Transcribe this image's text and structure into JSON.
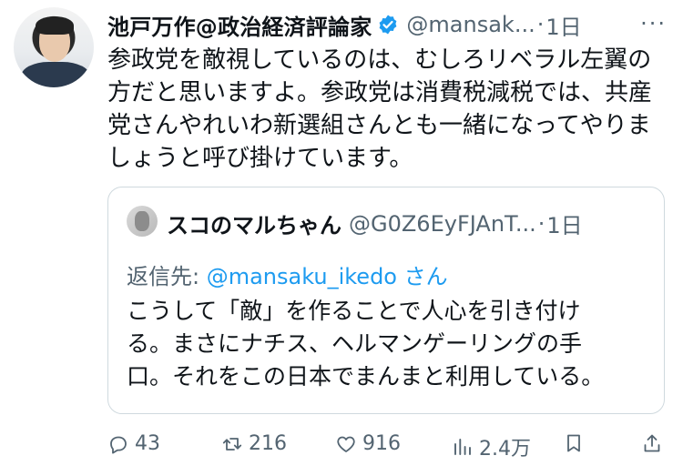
{
  "tweet": {
    "author_name": "池戸万作@政治経済評論家",
    "handle": "@mansak...",
    "time_sep": "·",
    "time": "1日",
    "more": "···",
    "text": "参政党を敵視しているのは、むしろリベラル左翼の\n方だと思いますよ。参政党は消費税減税では、共産\n党さんやれいわ新選組さんとも一緒になってやりま\nしょうと呼び掛けています。"
  },
  "quote": {
    "author_name": "スコのマルちゃん",
    "handle": "@G0Z6EyFJAnT...",
    "time_sep": "·",
    "time": "1日",
    "reply_prefix": "返信先: ",
    "reply_link": "@mansaku_ikedo",
    "reply_suffix": " さん",
    "text": "こうして「敵」を作ることで人心を引き付け\nる。まさにナチス、ヘルマンゲーリングの手\n口。それをこの日本でまんまと利用している。"
  },
  "actions": {
    "replies": "43",
    "reposts": "216",
    "likes": "916",
    "views": "2.4万"
  },
  "colors": {
    "accent": "#1d9bf0",
    "muted": "#536471",
    "border": "#cfd9de"
  }
}
